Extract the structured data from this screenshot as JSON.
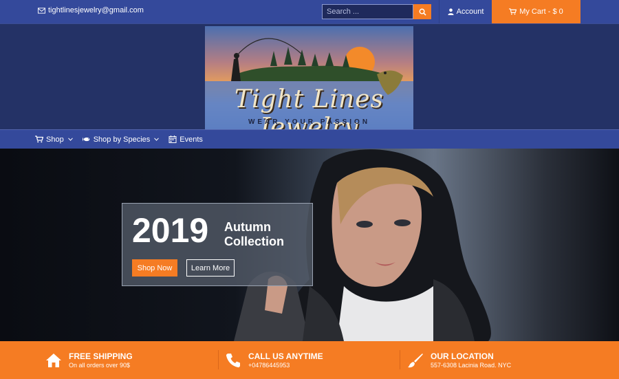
{
  "topbar": {
    "email": "tightlinesjewelry@gmail.com",
    "search_placeholder": "Search ...",
    "account_label": "Account",
    "cart_label": "My Cart - $ 0"
  },
  "logo": {
    "title": "Tight Lines Jewelry",
    "tagline": "WEAR YOUR PASSION"
  },
  "nav": {
    "items": [
      {
        "label": "Shop",
        "icon": "cart-icon",
        "has_dropdown": true
      },
      {
        "label": "Shop by Species",
        "icon": "fish-icon",
        "has_dropdown": true
      },
      {
        "label": "Events",
        "icon": "calendar-icon",
        "has_dropdown": false
      }
    ]
  },
  "hero": {
    "year": "2019",
    "collection": "Autumn Collection",
    "primary_button": "Shop Now",
    "secondary_button": "Learn More"
  },
  "features": [
    {
      "title": "FREE SHIPPING",
      "subtitle": "On all orders over 90$",
      "icon": "home-icon"
    },
    {
      "title": "CALL US ANYTIME",
      "subtitle": "+04786445953",
      "icon": "phone-icon"
    },
    {
      "title": "OUR LOCATION",
      "subtitle": "557-6308 Lacinia Road. NYC",
      "icon": "brush-icon"
    }
  ],
  "colors": {
    "accent": "#f57c23",
    "header_blue": "#34499b",
    "logo_band": "#243266"
  }
}
